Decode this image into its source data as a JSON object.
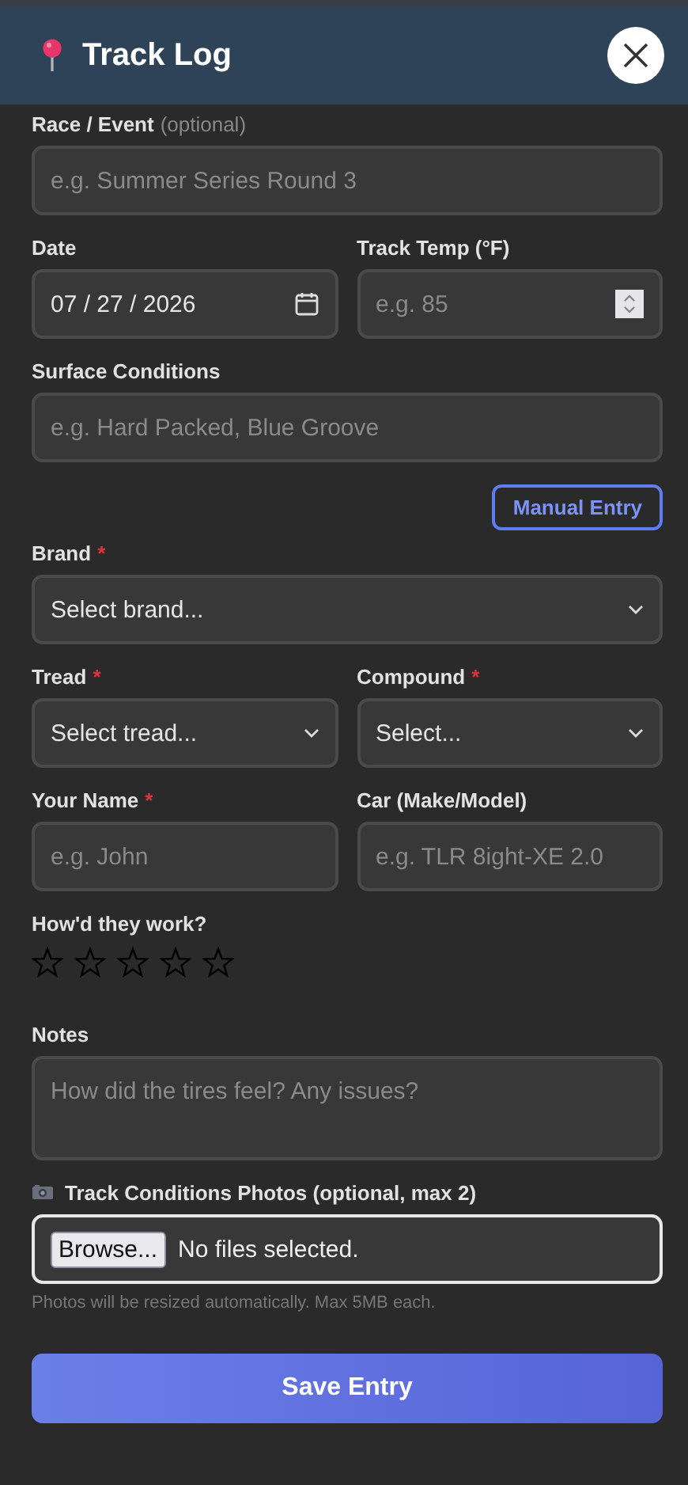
{
  "header": {
    "title": "Track Log"
  },
  "rows": [
    {
      "fields": [
        {
          "kind": "text",
          "label": "Race / Event",
          "note": "(optional)",
          "placeholder": "e.g. Summer Series Round 3"
        }
      ]
    },
    {
      "fields": [
        {
          "kind": "date",
          "label": "Date",
          "value": "07 / 27 / 2026"
        },
        {
          "kind": "number",
          "label": "Track Temp (°F)",
          "placeholder": "e.g. 85"
        }
      ]
    },
    {
      "fields": [
        {
          "kind": "text",
          "label": "Surface Conditions",
          "placeholder": "e.g. Hard Packed, Blue Groove"
        }
      ]
    },
    {
      "fields": [
        {
          "kind": "button",
          "label": "Manual Entry"
        }
      ]
    },
    {
      "fields": [
        {
          "kind": "select",
          "label": "Brand",
          "required_mark": "*",
          "value": "Select brand..."
        }
      ]
    },
    {
      "fields": [
        {
          "kind": "select",
          "label": "Tread",
          "required_mark": "*",
          "value": "Select tread..."
        },
        {
          "kind": "select",
          "label": "Compound",
          "required_mark": "*",
          "value": "Select..."
        }
      ]
    },
    {
      "fields": [
        {
          "kind": "text",
          "label": "Your Name",
          "required_mark": "*",
          "placeholder": "e.g. John"
        },
        {
          "kind": "text",
          "label": "Car (Make/Model)",
          "placeholder": "e.g. TLR 8ight-XE 2.0"
        }
      ]
    },
    {
      "fields": [
        {
          "kind": "rating",
          "label": "How'd they work?",
          "stars": 0
        }
      ]
    },
    {
      "fields": [
        {
          "kind": "textarea",
          "label": "Notes",
          "placeholder": "How did the tires feel? Any issues?"
        }
      ]
    },
    {
      "fields": [
        {
          "kind": "file",
          "label": "Track Conditions Photos (optional, max 2)",
          "button": "Browse...",
          "value": "No files selected.",
          "focused": true,
          "hint": "Photos will be resized automatically. Max 5MB each."
        }
      ]
    }
  ],
  "submit": {
    "label": "Save Entry"
  }
}
